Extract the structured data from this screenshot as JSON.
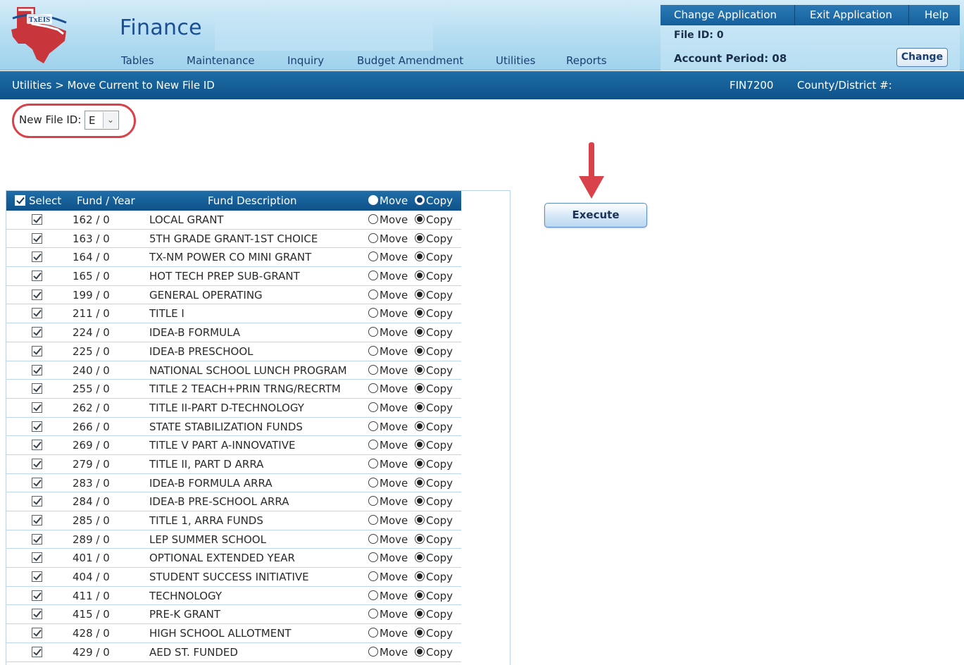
{
  "header": {
    "logo_text": "TxEIS",
    "app_title": "Finance",
    "menu": [
      "Tables",
      "Maintenance",
      "Inquiry",
      "Budget Amendment",
      "Utilities",
      "Reports"
    ],
    "top_links": [
      "Change Application",
      "Exit Application",
      "Help"
    ],
    "file_id": "File ID: 0",
    "account_period": "Account Period: 08",
    "change_label": "Change"
  },
  "breadcrumb": {
    "path": "Utilities > Move Current to New File ID",
    "page_code": "FIN7200",
    "county_district": "County/District #:"
  },
  "new_file_id": {
    "label": "New File ID:",
    "value": "E"
  },
  "execute_label": "Execute",
  "colors": {
    "header_bg": "#b3dcf1",
    "bar_bg": "#14609d",
    "annotation_red": "#d9424a"
  },
  "table": {
    "headers": {
      "select": "Select",
      "fund_year": "Fund / Year",
      "description": "Fund Description",
      "move": "Move",
      "copy": "Copy"
    },
    "rows": [
      {
        "fund": "162 / 0",
        "desc": "LOCAL GRANT"
      },
      {
        "fund": "163 / 0",
        "desc": "5TH GRADE GRANT-1ST CHOICE"
      },
      {
        "fund": "164 / 0",
        "desc": "TX-NM POWER CO MINI GRANT"
      },
      {
        "fund": "165 / 0",
        "desc": "HOT TECH PREP SUB-GRANT"
      },
      {
        "fund": "199 / 0",
        "desc": "GENERAL OPERATING"
      },
      {
        "fund": "211 / 0",
        "desc": "TITLE I"
      },
      {
        "fund": "224 / 0",
        "desc": "IDEA-B FORMULA"
      },
      {
        "fund": "225 / 0",
        "desc": "IDEA-B PRESCHOOL"
      },
      {
        "fund": "240 / 0",
        "desc": "NATIONAL SCHOOL LUNCH PROGRAM"
      },
      {
        "fund": "255 / 0",
        "desc": "TITLE 2 TEACH+PRIN TRNG/RECRTM"
      },
      {
        "fund": "262 / 0",
        "desc": "TITLE II-PART D-TECHNOLOGY"
      },
      {
        "fund": "266 / 0",
        "desc": "STATE STABILIZATION FUNDS"
      },
      {
        "fund": "269 / 0",
        "desc": "TITLE V PART A-INNOVATIVE"
      },
      {
        "fund": "279 / 0",
        "desc": "TITLE II, PART D ARRA"
      },
      {
        "fund": "283 / 0",
        "desc": "IDEA-B FORMULA ARRA"
      },
      {
        "fund": "284 / 0",
        "desc": "IDEA-B PRE-SCHOOL ARRA"
      },
      {
        "fund": "285 / 0",
        "desc": "TITLE 1, ARRA FUNDS"
      },
      {
        "fund": "289 / 0",
        "desc": "LEP SUMMER SCHOOL"
      },
      {
        "fund": "401 / 0",
        "desc": "OPTIONAL EXTENDED YEAR"
      },
      {
        "fund": "404 / 0",
        "desc": "STUDENT SUCCESS INITIATIVE"
      },
      {
        "fund": "411 / 0",
        "desc": "TECHNOLOGY"
      },
      {
        "fund": "415 / 0",
        "desc": "PRE-K GRANT"
      },
      {
        "fund": "428 / 0",
        "desc": "HIGH SCHOOL ALLOTMENT"
      },
      {
        "fund": "429 / 0",
        "desc": "AED ST. FUNDED"
      }
    ]
  }
}
